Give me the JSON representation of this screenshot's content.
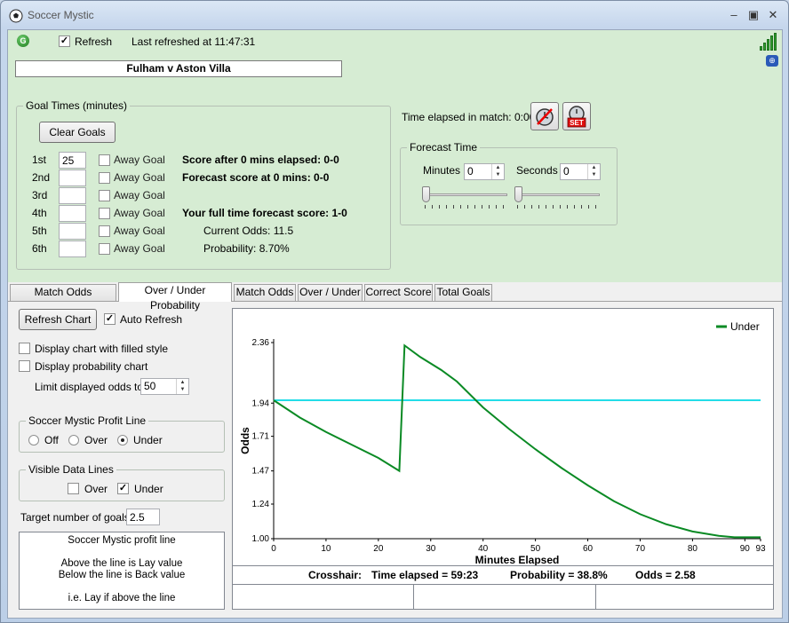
{
  "window": {
    "title": "Soccer Mystic"
  },
  "toolbar": {
    "refresh_label": "Refresh",
    "refresh_checked": true,
    "last_refreshed": "Last refreshed at 11:47:31",
    "g_icon": "G"
  },
  "match": {
    "title": "Fulham v Aston Villa"
  },
  "goal_times": {
    "group_label": "Goal Times (minutes)",
    "clear_label": "Clear Goals",
    "away_label": "Away Goal",
    "rows": [
      {
        "label": "1st",
        "value": "25"
      },
      {
        "label": "2nd",
        "value": ""
      },
      {
        "label": "3rd",
        "value": ""
      },
      {
        "label": "4th",
        "value": ""
      },
      {
        "label": "5th",
        "value": ""
      },
      {
        "label": "6th",
        "value": ""
      }
    ]
  },
  "scores": {
    "score_after": "Score after 0 mins elapsed: 0-0",
    "forecast_score": "Forecast score at 0 mins: 0-0",
    "full_time": "Your full time forecast score: 1-0",
    "current_odds": "Current Odds: 11.5",
    "probability": "Probability: 8.70%"
  },
  "time_elapsed": {
    "label": "Time elapsed in match: 0:00",
    "set_label": "SET"
  },
  "forecast": {
    "group_label": "Forecast Time",
    "minutes_label": "Minutes",
    "minutes_value": "0",
    "seconds_label": "Seconds",
    "seconds_value": "0",
    "minutes_slider": 0,
    "seconds_slider": 0
  },
  "tabs": [
    {
      "label": "Match Odds Probability",
      "active": false
    },
    {
      "label": "Over / Under Probability",
      "active": true
    },
    {
      "label": "Match Odds",
      "active": false
    },
    {
      "label": "Over / Under",
      "active": false
    },
    {
      "label": "Correct Score",
      "active": false
    },
    {
      "label": "Total Goals",
      "active": false
    }
  ],
  "left_panel": {
    "refresh_chart": "Refresh Chart",
    "auto_refresh": "Auto Refresh",
    "filled_style": "Display chart with filled style",
    "probability_chart": "Display probability chart",
    "limit_label": "Limit displayed odds to",
    "limit_value": "50",
    "profit_group": "Soccer Mystic Profit Line",
    "profit_options": [
      "Off",
      "Over",
      "Under"
    ],
    "profit_selected": "Under",
    "visible_group": "Visible Data Lines",
    "visible_over": "Over",
    "visible_under": "Under",
    "target_label": "Target number of goals",
    "target_value": "2.5",
    "info_title": "Soccer Mystic profit line",
    "info_line1": "Above the line is Lay value",
    "info_line2": "Below the line is Back value",
    "info_line3": "i.e. Lay if above the line"
  },
  "chart_data": {
    "type": "line",
    "xlabel": "Minutes Elapsed",
    "ylabel": "Odds",
    "xlim": [
      0,
      93
    ],
    "ylim": [
      1.0,
      2.36
    ],
    "xticks": [
      0,
      10,
      20,
      30,
      40,
      50,
      60,
      70,
      80,
      90,
      93
    ],
    "yticks": [
      "1.00",
      "1.24",
      "1.47",
      "1.71",
      "1.94",
      "2.36"
    ],
    "ytick_values": [
      1.0,
      1.24,
      1.47,
      1.71,
      1.94,
      2.36
    ],
    "legend_position": "top-right",
    "series": [
      {
        "name": "Under",
        "color": "#0a8a24",
        "x": [
          0,
          5,
          10,
          15,
          20,
          24,
          25,
          28,
          32,
          35,
          40,
          45,
          50,
          55,
          60,
          65,
          70,
          75,
          80,
          85,
          88,
          90,
          93
        ],
        "y": [
          1.96,
          1.84,
          1.74,
          1.65,
          1.56,
          1.47,
          2.34,
          2.26,
          2.17,
          2.09,
          1.91,
          1.76,
          1.62,
          1.49,
          1.37,
          1.26,
          1.17,
          1.1,
          1.05,
          1.02,
          1.01,
          1.01,
          1.01
        ]
      }
    ],
    "profit_line": {
      "y": 1.96,
      "color": "#22dde8"
    }
  },
  "crosshair": {
    "label": "Crosshair:",
    "time": "Time elapsed = 59:23",
    "probability": "Probability = 38.8%",
    "odds": "Odds = 2.58"
  }
}
